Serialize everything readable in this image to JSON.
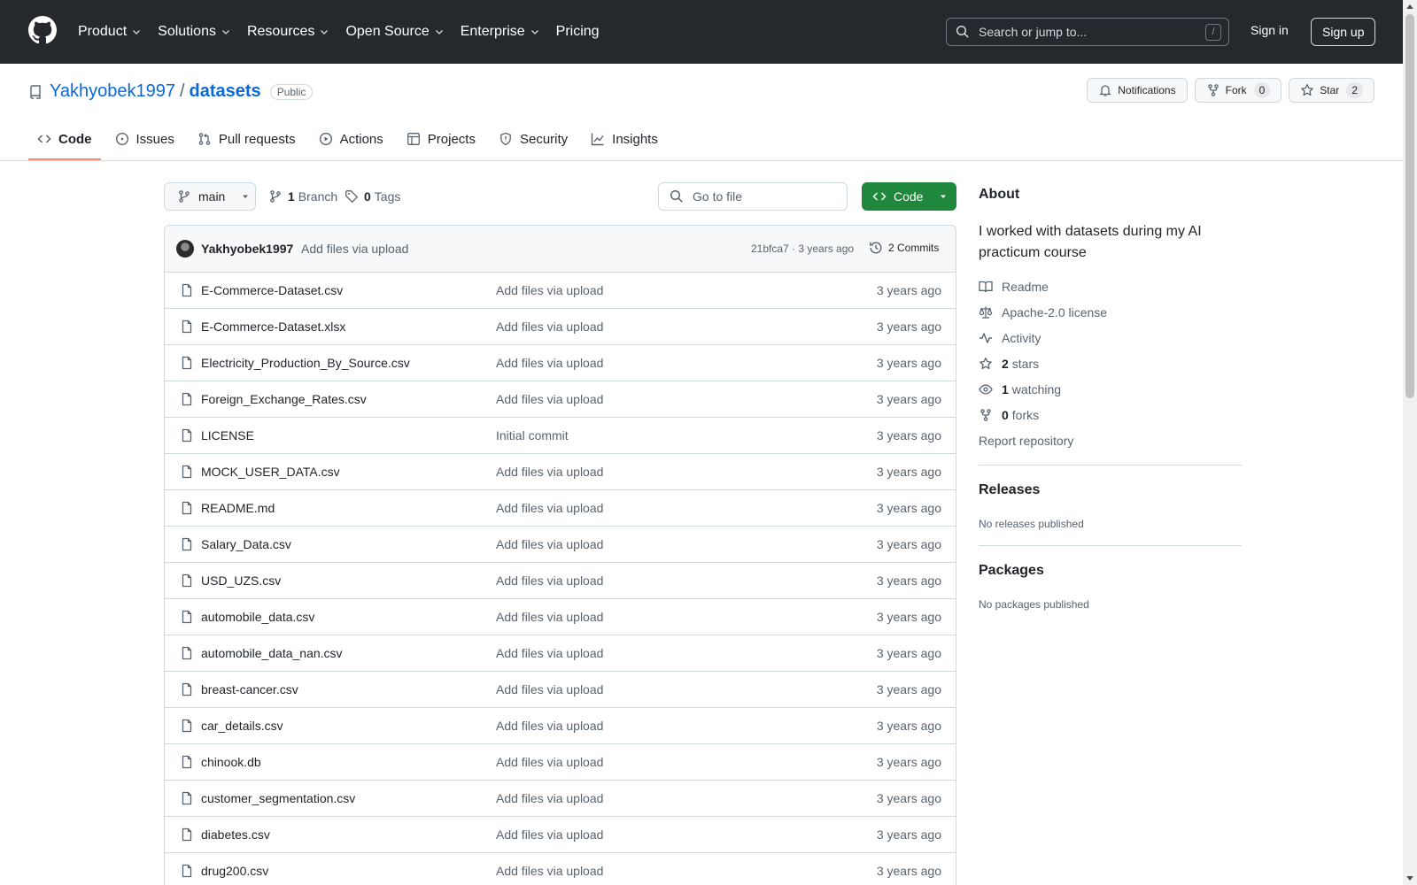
{
  "header": {
    "nav": [
      {
        "label": "Product"
      },
      {
        "label": "Solutions"
      },
      {
        "label": "Resources"
      },
      {
        "label": "Open Source"
      },
      {
        "label": "Enterprise"
      },
      {
        "label": "Pricing"
      }
    ],
    "search_placeholder": "Search or jump to...",
    "search_key": "/",
    "sign_in": "Sign in",
    "sign_up": "Sign up"
  },
  "repo": {
    "owner": "Yakhyobek1997",
    "separator": "/",
    "name": "datasets",
    "visibility": "Public",
    "notifications_label": "Notifications",
    "fork_label": "Fork",
    "fork_count": "0",
    "star_label": "Star",
    "star_count": "2",
    "tabs": [
      {
        "label": "Code",
        "icon": "code-icon"
      },
      {
        "label": "Issues",
        "icon": "issue-icon"
      },
      {
        "label": "Pull requests",
        "icon": "pull-request-icon"
      },
      {
        "label": "Actions",
        "icon": "play-icon"
      },
      {
        "label": "Projects",
        "icon": "table-icon"
      },
      {
        "label": "Security",
        "icon": "shield-icon"
      },
      {
        "label": "Insights",
        "icon": "graph-icon"
      }
    ]
  },
  "browser": {
    "branch": "main",
    "branch_count": "1",
    "branch_label": "Branch",
    "tag_count": "0",
    "tag_label": "Tags",
    "go_to_file": "Go to file",
    "code_button": "Code",
    "commit": {
      "author": "Yakhyobek1997",
      "message": "Add files via upload",
      "meta": "21bfca7 · 3 years ago",
      "commits": "2 Commits"
    },
    "files": [
      {
        "name": "E-Commerce-Dataset.csv",
        "message": "Add files via upload",
        "age": "3 years ago"
      },
      {
        "name": "E-Commerce-Dataset.xlsx",
        "message": "Add files via upload",
        "age": "3 years ago"
      },
      {
        "name": "Electricity_Production_By_Source.csv",
        "message": "Add files via upload",
        "age": "3 years ago"
      },
      {
        "name": "Foreign_Exchange_Rates.csv",
        "message": "Add files via upload",
        "age": "3 years ago"
      },
      {
        "name": "LICENSE",
        "message": "Initial commit",
        "age": "3 years ago"
      },
      {
        "name": "MOCK_USER_DATA.csv",
        "message": "Add files via upload",
        "age": "3 years ago"
      },
      {
        "name": "README.md",
        "message": "Add files via upload",
        "age": "3 years ago"
      },
      {
        "name": "Salary_Data.csv",
        "message": "Add files via upload",
        "age": "3 years ago"
      },
      {
        "name": "USD_UZS.csv",
        "message": "Add files via upload",
        "age": "3 years ago"
      },
      {
        "name": "automobile_data.csv",
        "message": "Add files via upload",
        "age": "3 years ago"
      },
      {
        "name": "automobile_data_nan.csv",
        "message": "Add files via upload",
        "age": "3 years ago"
      },
      {
        "name": "breast-cancer.csv",
        "message": "Add files via upload",
        "age": "3 years ago"
      },
      {
        "name": "car_details.csv",
        "message": "Add files via upload",
        "age": "3 years ago"
      },
      {
        "name": "chinook.db",
        "message": "Add files via upload",
        "age": "3 years ago"
      },
      {
        "name": "customer_segmentation.csv",
        "message": "Add files via upload",
        "age": "3 years ago"
      },
      {
        "name": "diabetes.csv",
        "message": "Add files via upload",
        "age": "3 years ago"
      },
      {
        "name": "drug200.csv",
        "message": "Add files via upload",
        "age": "3 years ago"
      }
    ]
  },
  "sidebar": {
    "about_title": "About",
    "description": "I worked with datasets during my AI practicum course",
    "readme": "Readme",
    "license": "Apache-2.0 license",
    "activity": "Activity",
    "stars_count": "2",
    "stars_label": "stars",
    "watching_count": "1",
    "watching_label": "watching",
    "forks_count": "0",
    "forks_label": "forks",
    "report": "Report repository",
    "releases_title": "Releases",
    "releases_sub": "No releases published",
    "packages_title": "Packages",
    "packages_sub": "No packages published"
  },
  "colors": {
    "header_bg": "#25292e",
    "link": "#0969da",
    "code_button": "#1f883d",
    "active_tab_underline": "#fd8c73"
  }
}
